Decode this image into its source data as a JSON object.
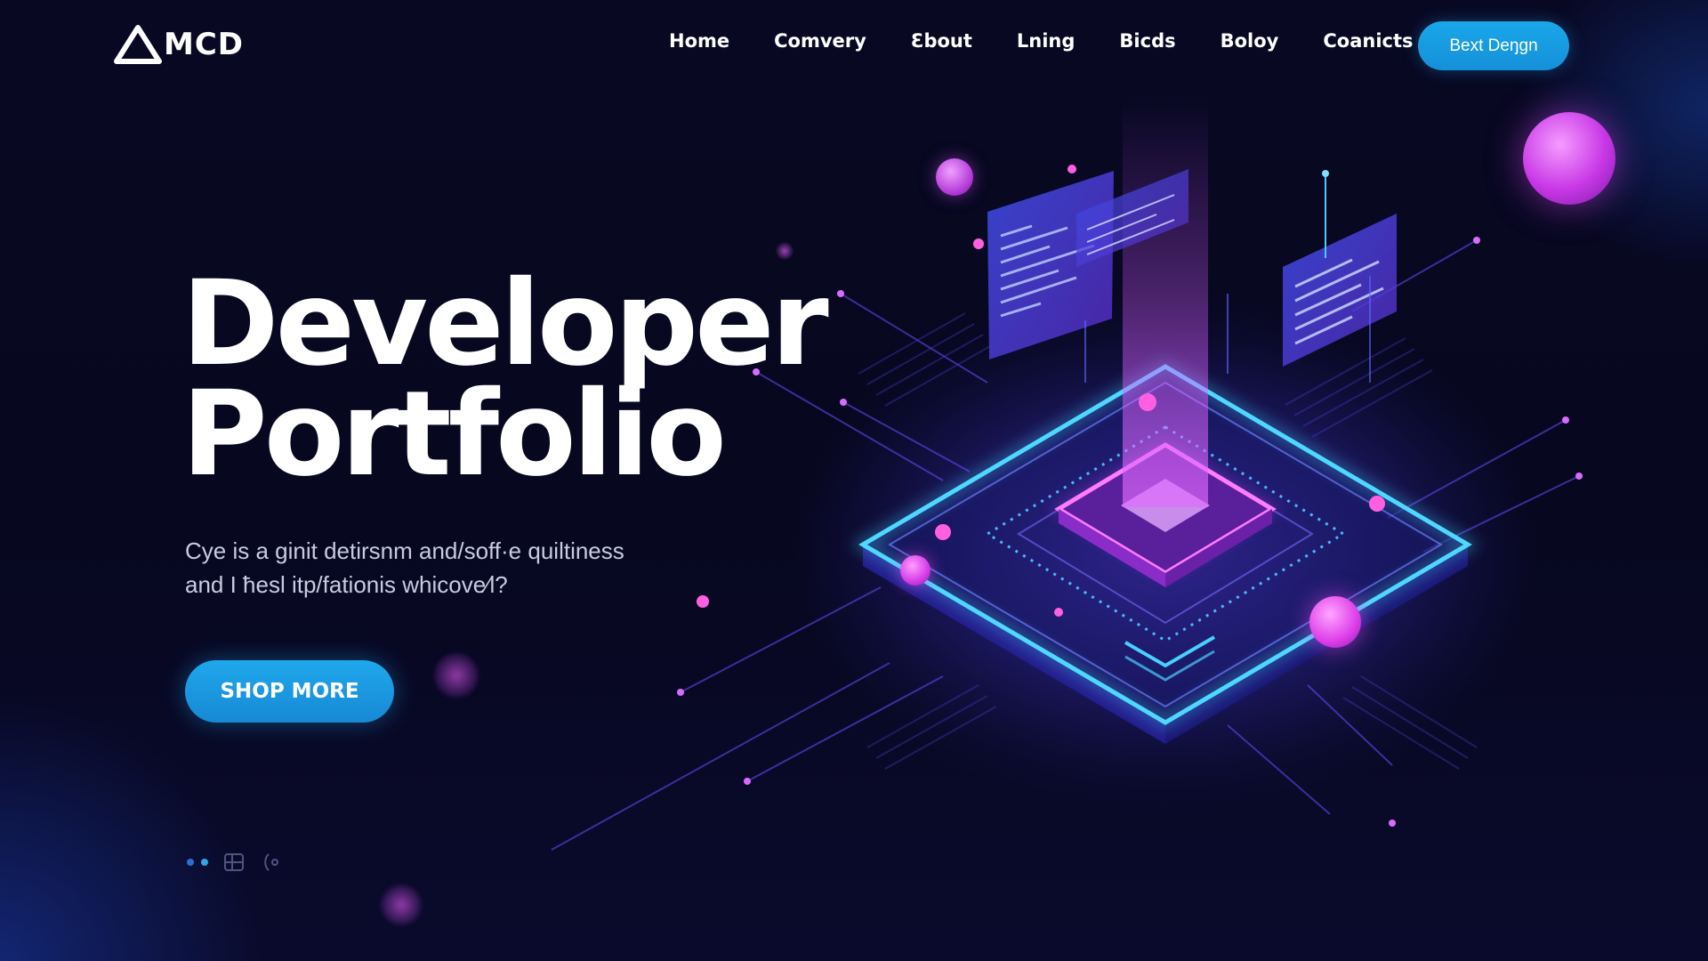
{
  "header": {
    "logo_text": "MCD",
    "nav": [
      "Home",
      "Comvery",
      "Ɛbout",
      "Lning",
      "Bicds",
      "Boloy",
      "Coanicts"
    ],
    "cta_label": "Bext Deŋgn"
  },
  "hero": {
    "title_line1": "Developer",
    "title_line2": "Portfolio",
    "subtitle_line1": "Cye is a ginit detirsnm and/soff·e quiltiness",
    "subtitle_line2": "and I ħesl itp/fationis whicove⁄l?",
    "cta_label": "SHOP MORE"
  },
  "colors": {
    "accent": "#1fa7ec",
    "background": "#07071f",
    "glow_cyan": "#38c8ff",
    "glow_magenta": "#d24cff"
  },
  "icons": [
    "logo-triangle-icon",
    "pager-dots-icon",
    "layers-icon",
    "scroll-icon"
  ]
}
